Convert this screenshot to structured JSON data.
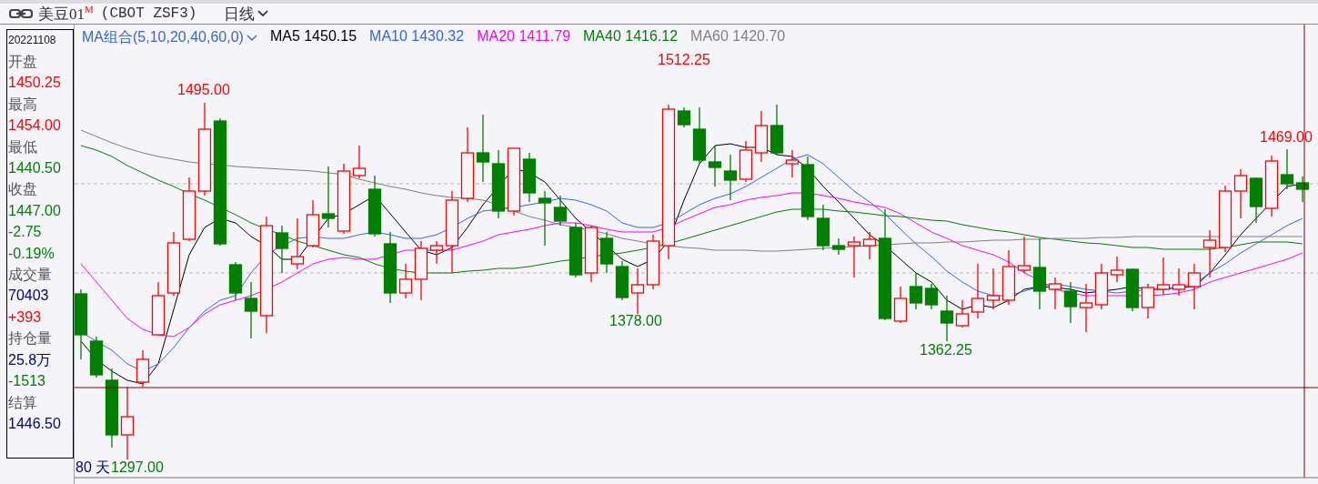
{
  "header": {
    "symbol": "美豆01",
    "badge": "M",
    "contract": "(CBOT ZSF3)",
    "period": "日线"
  },
  "info_panel": {
    "date": "20221108",
    "rows": [
      {
        "kind": "label",
        "text": "开盘"
      },
      {
        "kind": "value",
        "text": "1450.25",
        "color": "#ff0000"
      },
      {
        "kind": "label",
        "text": "最高"
      },
      {
        "kind": "value",
        "text": "1454.00",
        "color": "#ff0000"
      },
      {
        "kind": "label",
        "text": "最低"
      },
      {
        "kind": "value",
        "text": "1440.50",
        "color": "#008000"
      },
      {
        "kind": "label",
        "text": "收盘"
      },
      {
        "kind": "value",
        "text": "1447.00",
        "color": "#008000"
      },
      {
        "kind": "value",
        "text": "-2.75",
        "color": "#008000"
      },
      {
        "kind": "value",
        "text": "-0.19%",
        "color": "#008000"
      },
      {
        "kind": "label",
        "text": "成交量"
      },
      {
        "kind": "value",
        "text": "70403",
        "color": "#000080"
      },
      {
        "kind": "value",
        "text": "+393",
        "color": "#ff0000"
      },
      {
        "kind": "label",
        "text": "持仓量"
      },
      {
        "kind": "value",
        "text": "25.8万",
        "color": "#000080"
      },
      {
        "kind": "value",
        "text": "-1513",
        "color": "#008000"
      },
      {
        "kind": "label",
        "text": "结算"
      },
      {
        "kind": "value",
        "text": "1446.50",
        "color": "#000080"
      }
    ]
  },
  "legend": {
    "title": "MA组合(5,10,20,40,60,0)",
    "items": [
      {
        "text": "MA5 1450.15",
        "color": "#000000"
      },
      {
        "text": "MA10 1430.32",
        "color": "#3366ee"
      },
      {
        "text": "MA20 1411.79",
        "color": "#ff00ff"
      },
      {
        "text": "MA40 1416.12",
        "color": "#007f00"
      },
      {
        "text": "MA60 1420.70",
        "color": "#808080"
      }
    ]
  },
  "chart": {
    "day_count": "80 天",
    "price_labels": [
      {
        "text": "1495.00",
        "kind": "high"
      },
      {
        "text": "1512.25",
        "kind": "high"
      },
      {
        "text": "1378.00",
        "kind": "low"
      },
      {
        "text": "1362.25",
        "kind": "low"
      },
      {
        "text": "1469.00",
        "kind": "high"
      },
      {
        "text": "1297.00",
        "kind": "low"
      }
    ]
  }
}
